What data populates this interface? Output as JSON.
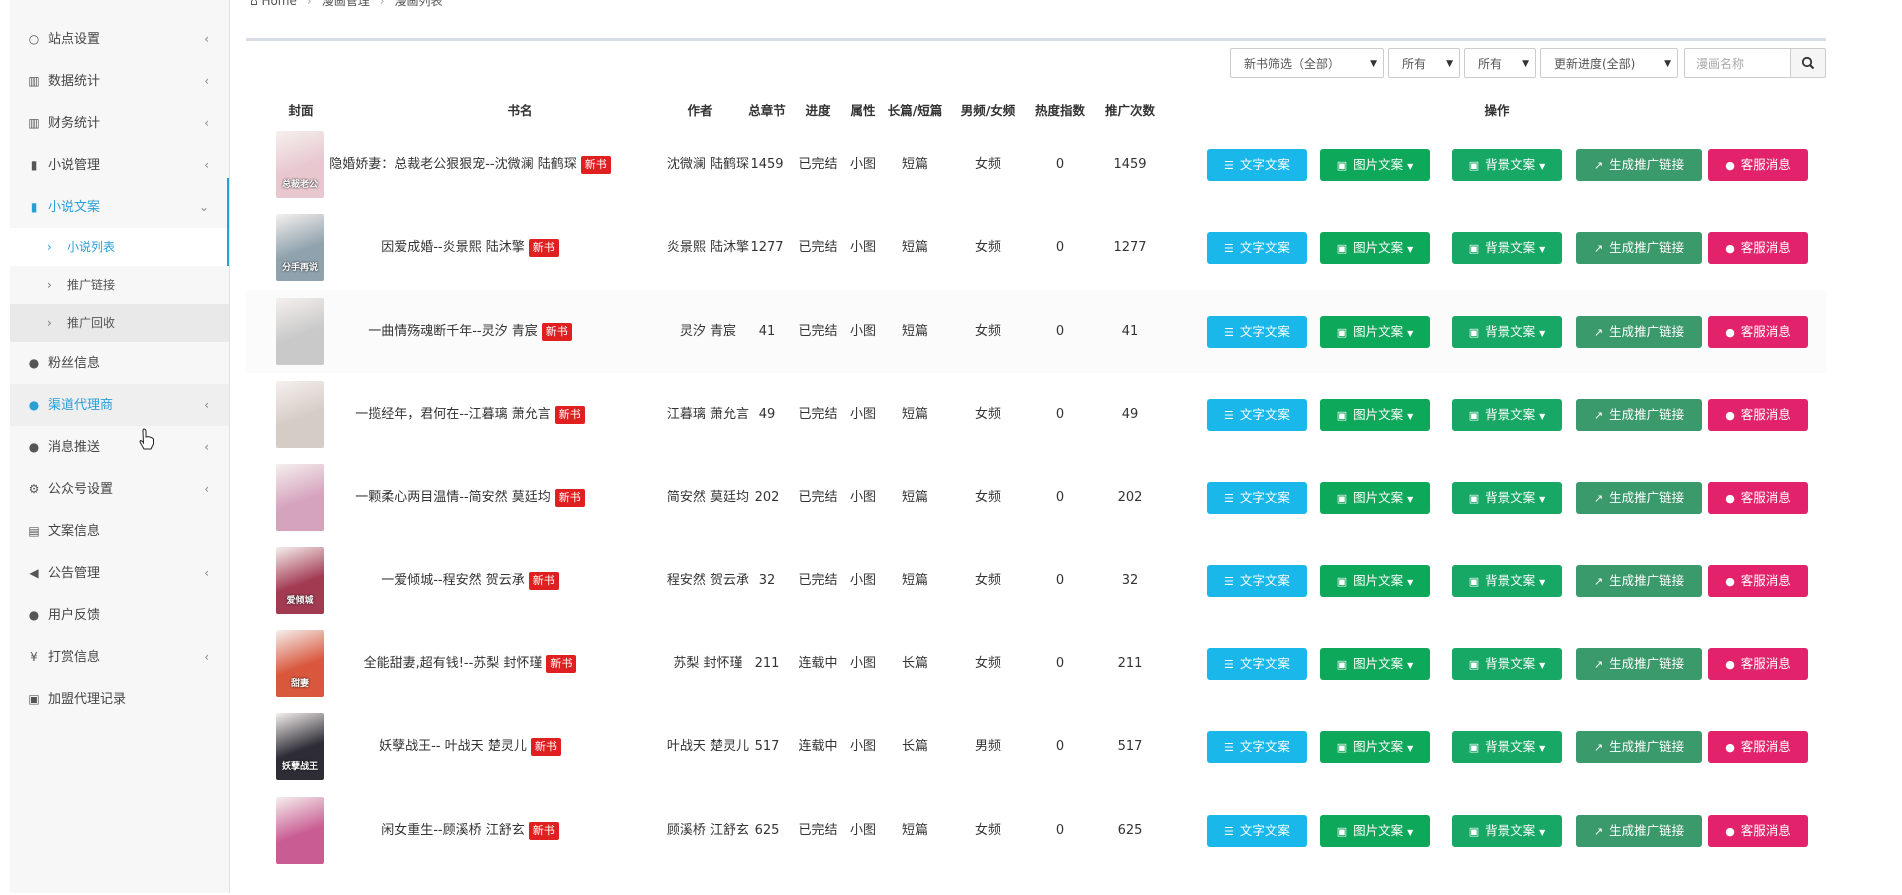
{
  "sidebar": {
    "items": [
      {
        "label": "站点设置",
        "icon": "○",
        "chevron": "‹"
      },
      {
        "label": "数据统计",
        "icon": "▥",
        "chevron": "‹"
      },
      {
        "label": "财务统计",
        "icon": "▥",
        "chevron": "‹"
      },
      {
        "label": "小说管理",
        "icon": "▮",
        "chevron": "‹"
      },
      {
        "label": "小说文案",
        "icon": "▮",
        "chevron": "⌄"
      }
    ],
    "sub_items": [
      {
        "label": "小说列表"
      },
      {
        "label": "推广链接"
      },
      {
        "label": "推广回收"
      }
    ],
    "items2": [
      {
        "label": "粉丝信息",
        "icon": "●",
        "chevron": ""
      },
      {
        "label": "渠道代理商",
        "icon": "●",
        "chevron": "‹"
      },
      {
        "label": "消息推送",
        "icon": "●",
        "chevron": "‹"
      },
      {
        "label": "公众号设置",
        "icon": "⚙",
        "chevron": "‹"
      },
      {
        "label": "文案信息",
        "icon": "▤",
        "chevron": ""
      },
      {
        "label": "公告管理",
        "icon": "◀",
        "chevron": "‹"
      },
      {
        "label": "用户反馈",
        "icon": "●",
        "chevron": ""
      },
      {
        "label": "打赏信息",
        "icon": "¥",
        "chevron": "‹"
      },
      {
        "label": "加盟代理记录",
        "icon": "▣",
        "chevron": ""
      }
    ]
  },
  "breadcrumb": {
    "home": "Home",
    "b1": "漫画管理",
    "b2": "漫画列表"
  },
  "filters": {
    "newbook": "新书筛选（全部）",
    "attr1": "所有",
    "attr2": "所有",
    "progress": "更新进度(全部)",
    "search_placeholder": "漫画名称"
  },
  "table": {
    "headers": [
      "封面",
      "书名",
      "作者",
      "总章节",
      "进度",
      "属性",
      "长篇/短篇",
      "男频/女频",
      "热度指数",
      "推广次数",
      "操作"
    ],
    "new_tag": "新书",
    "actions": {
      "text": "文字文案",
      "image": "图片文案",
      "bg": "背景文案",
      "link": "生成推广链接",
      "msg": "客服消息"
    },
    "rows": [
      {
        "title": "隐婚娇妻：总裁老公狠狠宠--沈微澜 陆鹤琛",
        "author": "沈微澜 陆鹤琛",
        "chapters": "1459",
        "progress": "已完结",
        "attr": "小图",
        "length": "短篇",
        "gender": "女频",
        "heat": "0",
        "promo": "1459",
        "cover_text": "总裁老公",
        "cover_color": "#e8c7cf"
      },
      {
        "title": "因爱成婚--炎景熙 陆沐擎",
        "author": "炎景熙 陆沐擎",
        "chapters": "1277",
        "progress": "已完结",
        "attr": "小图",
        "length": "短篇",
        "gender": "女频",
        "heat": "0",
        "promo": "1277",
        "cover_text": "分手再说",
        "cover_color": "#8fa2ad"
      },
      {
        "title": "一曲情殇魂断千年--灵汐 青宸",
        "author": "灵汐 青宸",
        "chapters": "41",
        "progress": "已完结",
        "attr": "小图",
        "length": "短篇",
        "gender": "女频",
        "heat": "0",
        "promo": "41",
        "cover_text": "",
        "cover_color": "#c9c9c9"
      },
      {
        "title": "一揽经年，君何在--江暮璃 萧允言",
        "author": "江暮璃 萧允言",
        "chapters": "49",
        "progress": "已完结",
        "attr": "小图",
        "length": "短篇",
        "gender": "女频",
        "heat": "0",
        "promo": "49",
        "cover_text": "",
        "cover_color": "#d5ccc6"
      },
      {
        "title": "一颗柔心两目温情--简安然 莫廷均",
        "author": "简安然 莫廷均",
        "chapters": "202",
        "progress": "已完结",
        "attr": "小图",
        "length": "短篇",
        "gender": "女频",
        "heat": "0",
        "promo": "202",
        "cover_text": "",
        "cover_color": "#d6a3bd"
      },
      {
        "title": "一爱倾城--程安然 贺云承",
        "author": "程安然 贺云承",
        "chapters": "32",
        "progress": "已完结",
        "attr": "小图",
        "length": "短篇",
        "gender": "女频",
        "heat": "0",
        "promo": "32",
        "cover_text": "爱倾城",
        "cover_color": "#a23a52"
      },
      {
        "title": "全能甜妻,超有钱!--苏梨 封怀瑾",
        "author": "苏梨 封怀瑾",
        "chapters": "211",
        "progress": "连载中",
        "attr": "小图",
        "length": "长篇",
        "gender": "女频",
        "heat": "0",
        "promo": "211",
        "cover_text": "甜妻",
        "cover_color": "#d9573c"
      },
      {
        "title": "妖孽战王-- 叶战天 楚灵儿",
        "author": "叶战天 楚灵儿",
        "chapters": "517",
        "progress": "连载中",
        "attr": "小图",
        "length": "长篇",
        "gender": "男频",
        "heat": "0",
        "promo": "517",
        "cover_text": "妖孽战王",
        "cover_color": "#2e2d36"
      },
      {
        "title": "闲女重生--顾溪桥 江舒玄",
        "author": "顾溪桥 江舒玄",
        "chapters": "625",
        "progress": "已完结",
        "attr": "小图",
        "length": "短篇",
        "gender": "女频",
        "heat": "0",
        "promo": "625",
        "cover_text": "",
        "cover_color": "#c95d93"
      }
    ]
  },
  "colors": {
    "accent": "#2a9fd6",
    "text_btn": "#1ab7ea",
    "img_btn": "#0ea85a",
    "bg_btn": "#17a866",
    "link_btn": "#3b9a6c",
    "msg_btn": "#e2236b",
    "new_tag": "#e02020"
  }
}
